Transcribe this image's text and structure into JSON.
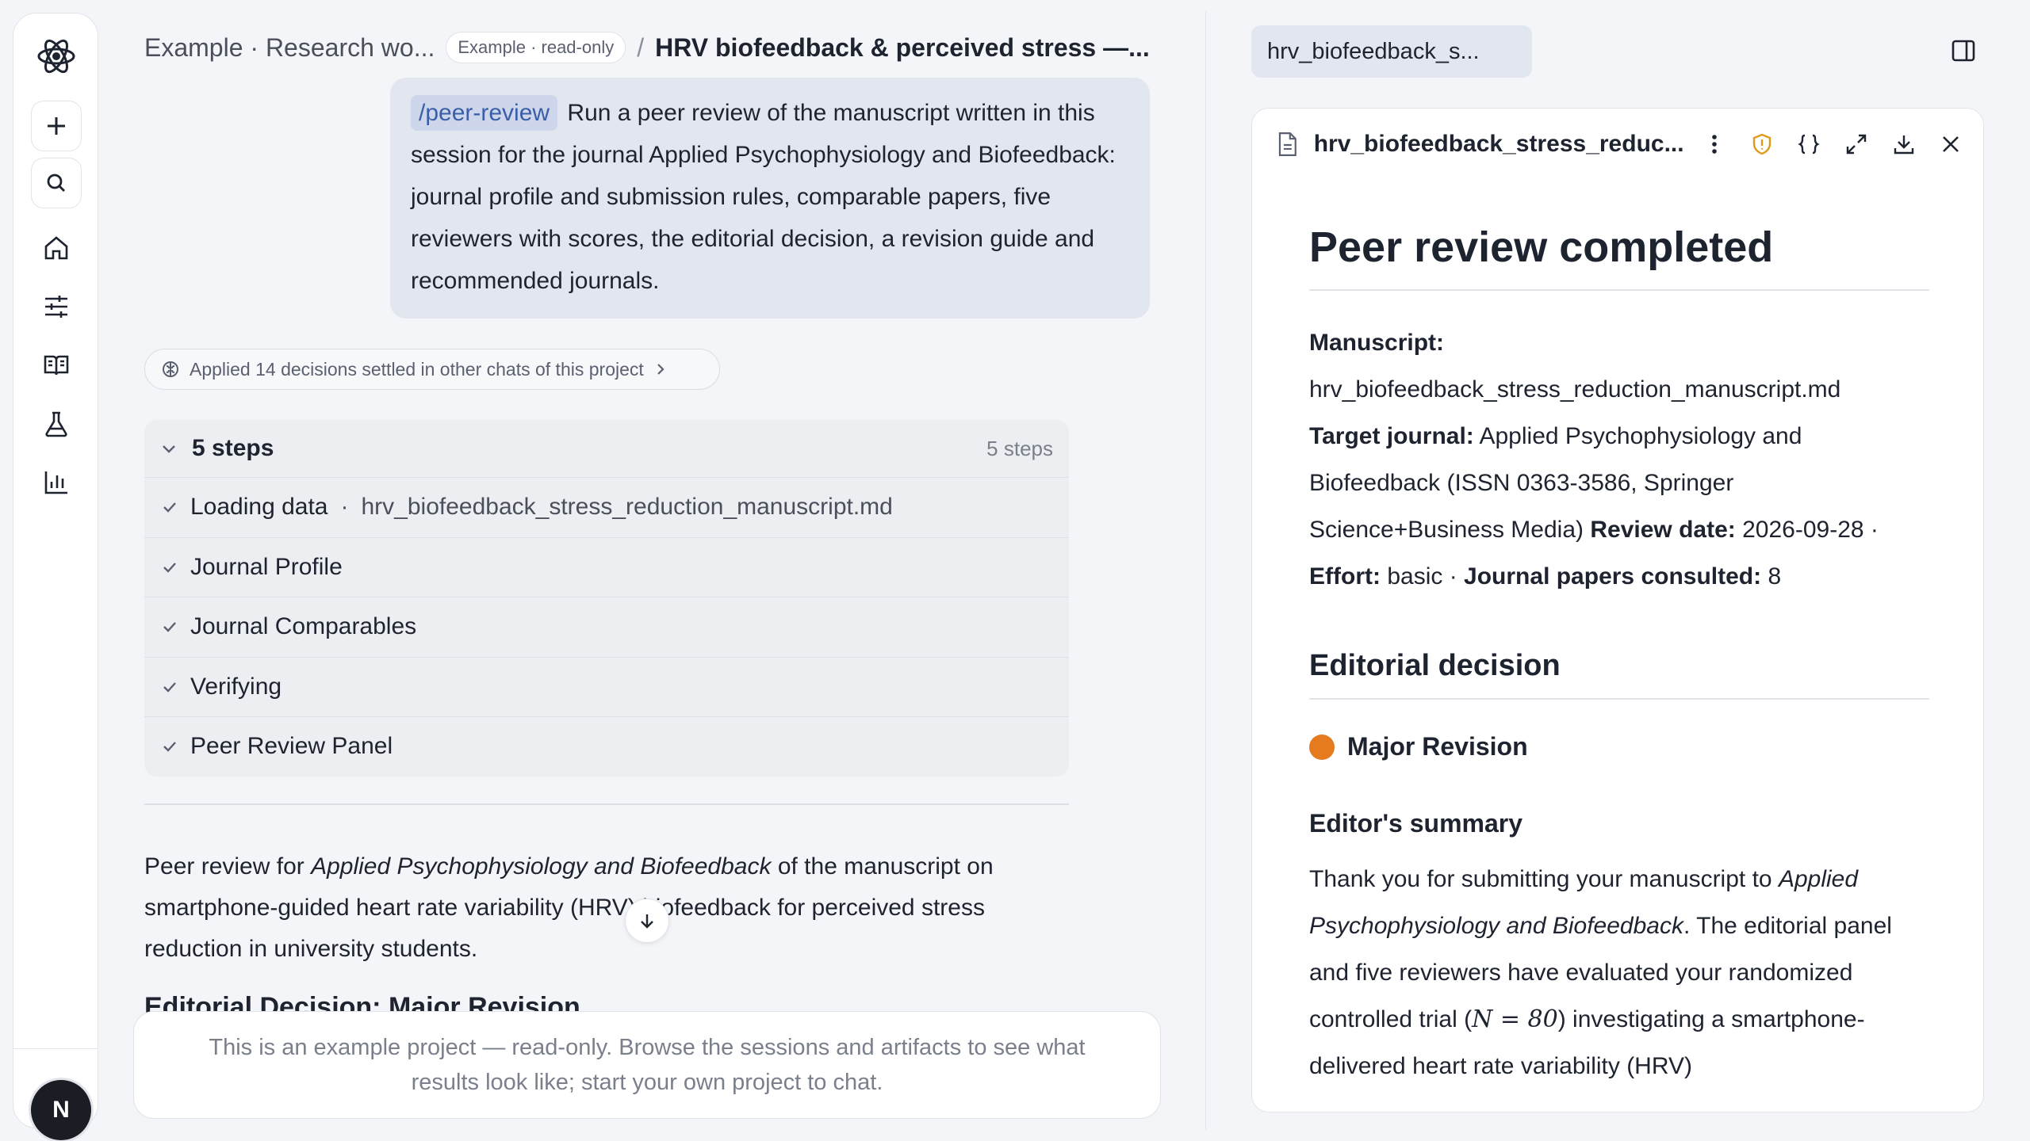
{
  "rail": {
    "logo_icon": "atom-icon",
    "avatar_initial": "N",
    "nav_icons": [
      "home-icon",
      "sliders-icon",
      "book-open-icon",
      "flask-icon",
      "bar-chart-icon"
    ]
  },
  "breadcrumb": {
    "project": "Example · Research wo...",
    "badge": "Example · read-only",
    "separator": "/",
    "chat_title": "HRV biofeedback & perceived stress —..."
  },
  "prompt": {
    "command": "/peer-review",
    "text": "Run a peer review of the manuscript written in this session for the journal Applied Psychophysiology and Biofeedback: journal profile and submission rules, comparable papers, five reviewers with scores, the editorial decision, a revision guide and recommended journals."
  },
  "decisions_chip": "Applied 14 decisions settled in other chats of this project",
  "steps": {
    "title": "5 steps",
    "count": "5 steps",
    "items": [
      {
        "label": "Loading data",
        "detail": "hrv_biofeedback_stress_reduction_manuscript.md"
      },
      {
        "label": "Journal Profile",
        "detail": ""
      },
      {
        "label": "Journal Comparables",
        "detail": ""
      },
      {
        "label": "Verifying",
        "detail": ""
      },
      {
        "label": "Peer Review Panel",
        "detail": ""
      }
    ]
  },
  "answer": {
    "p1": "Peer review for",
    "journal": "Applied Psychophysiology and Biofeedback",
    "p2": "of the manuscript on smartphone-guided heart rate variability (HRV) biofeedback for perceived stress reduction in university students.",
    "heading": "Editorial Decision: Major Revision"
  },
  "composer_notice": "This is an example project — read-only. Browse the sessions and artifacts to see what results look like; start your own project to chat.",
  "file_tab": "hrv_biofeedback_s...",
  "viewer": {
    "filename": "hrv_biofeedback_stress_reduc...",
    "toolbar_icons": [
      "more-vertical-icon",
      "shield-icon",
      "braces-icon",
      "expand-icon",
      "download-icon",
      "close-icon"
    ],
    "doc": {
      "title": "Peer review completed",
      "manuscript_label": "Manuscript:",
      "manuscript": "hrv_biofeedback_stress_reduction_manuscript.md",
      "target_label": "Target journal:",
      "target": "Applied Psychophysiology and Biofeedback (ISSN 0363-3586, Springer Science+Business Media)",
      "review_date_label": "Review date:",
      "review_date": "2026-09-28",
      "effort_label": "Effort:",
      "effort": "basic",
      "papers_label": "Journal papers consulted:",
      "papers": "8",
      "decision_heading": "Editorial decision",
      "decision": "Major Revision",
      "decision_color": "#e57a1f",
      "summary_heading": "Editor's summary",
      "summary_p1": "Thank you for submitting your manuscript to",
      "summary_journal": "Applied Psychophysiology and Biofeedback",
      "summary_p2": ". The editorial panel and five reviewers have evaluated your randomized controlled trial (",
      "summary_n": "N = 80",
      "summary_p3": ") investigating a smartphone-delivered heart rate variability (HRV)"
    }
  }
}
